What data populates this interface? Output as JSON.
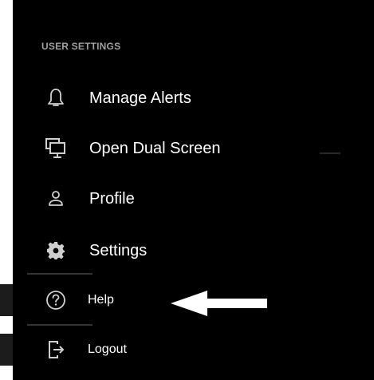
{
  "menu": {
    "section_title": "USER SETTINGS",
    "items": [
      {
        "label": "Manage Alerts",
        "icon": "bell-icon"
      },
      {
        "label": "Open Dual Screen",
        "icon": "monitor-icon"
      },
      {
        "label": "Profile",
        "icon": "user-icon"
      },
      {
        "label": "Settings",
        "icon": "gear-icon"
      },
      {
        "label": "Help",
        "icon": "help-circle-icon"
      },
      {
        "label": "Logout",
        "icon": "logout-icon"
      }
    ]
  },
  "annotation": {
    "arrow_color": "#ffffff"
  },
  "colors": {
    "background": "#000000",
    "text": "#ffffff",
    "header_text": "#a0a0a0",
    "icon": "#cfcfcf"
  }
}
